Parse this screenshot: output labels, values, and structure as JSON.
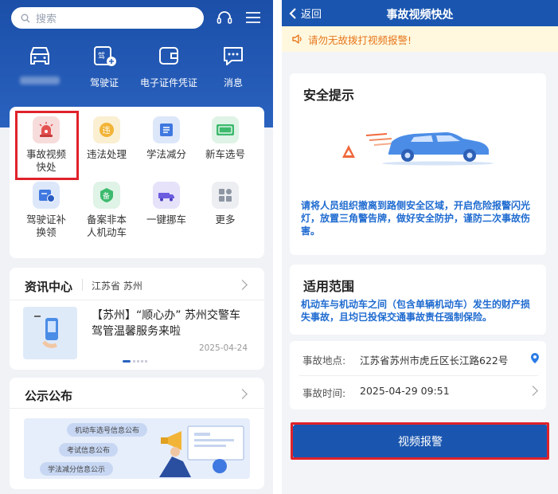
{
  "left": {
    "search_placeholder": "搜索",
    "quick_actions": [
      {
        "label": "",
        "icon": "car-icon"
      },
      {
        "label": "驾驶证",
        "icon": "license-icon"
      },
      {
        "label": "电子证件凭证",
        "icon": "wallet-icon"
      },
      {
        "label": "消息",
        "icon": "message-icon"
      }
    ],
    "services": [
      {
        "label": "事故视频\n快处",
        "icon": "alarm-icon",
        "color": "#f7dcdc"
      },
      {
        "label": "违法处理",
        "icon": "violation-icon",
        "color": "#fbefd2"
      },
      {
        "label": "学法减分",
        "icon": "book-icon",
        "color": "#dde7fa"
      },
      {
        "label": "新车选号",
        "icon": "plate-icon",
        "color": "#dff3e6"
      },
      {
        "label": "驾驶证补\n换领",
        "icon": "id-card-icon",
        "color": "#dde7fa"
      },
      {
        "label": "备案非本\n人机动车",
        "icon": "record-icon",
        "color": "#dff3e6"
      },
      {
        "label": "一键挪车",
        "icon": "tow-truck-icon",
        "color": "#e5e2fa"
      },
      {
        "label": "更多",
        "icon": "more-grid-icon",
        "color": "#eceef2"
      }
    ],
    "news": {
      "title": "资讯中心",
      "region": "江苏省 苏州",
      "headline": "【苏州】“顺心办” 苏州交警车驾管温馨服务来啦",
      "date": "2025-04-24"
    },
    "announcements": {
      "title": "公示公布",
      "tags": [
        "机动车选号信息公布",
        "考试信息公布",
        "学法减分信息公示"
      ]
    }
  },
  "right": {
    "back_label": "返回",
    "page_title": "事故视频快处",
    "notice": "请勿无故拨打视频报警!",
    "safety_title": "安全提示",
    "safety_text": "请将人员组织撤离到路侧安全区域，开启危险报警闪光灯，放置三角警告牌，做好安全防护，谨防二次事故伤害。",
    "scope_title": "适用范围",
    "scope_text": "机动车与机动车之间（包含单辆机动车）发生的财产损失事故，且均已投保交通事故责任强制保险。",
    "location_label": "事故地点:",
    "location_value": "江苏省苏州市虎丘区长江路622号",
    "time_label": "事故时间:",
    "time_value": "2025-04-29 09:51",
    "report_button": "视频报警"
  },
  "colors": {
    "brand_blue": "#1a56b0",
    "highlight_red": "#e0222a",
    "notice_orange": "#e6761c",
    "info_blue": "#1f6bd0"
  }
}
